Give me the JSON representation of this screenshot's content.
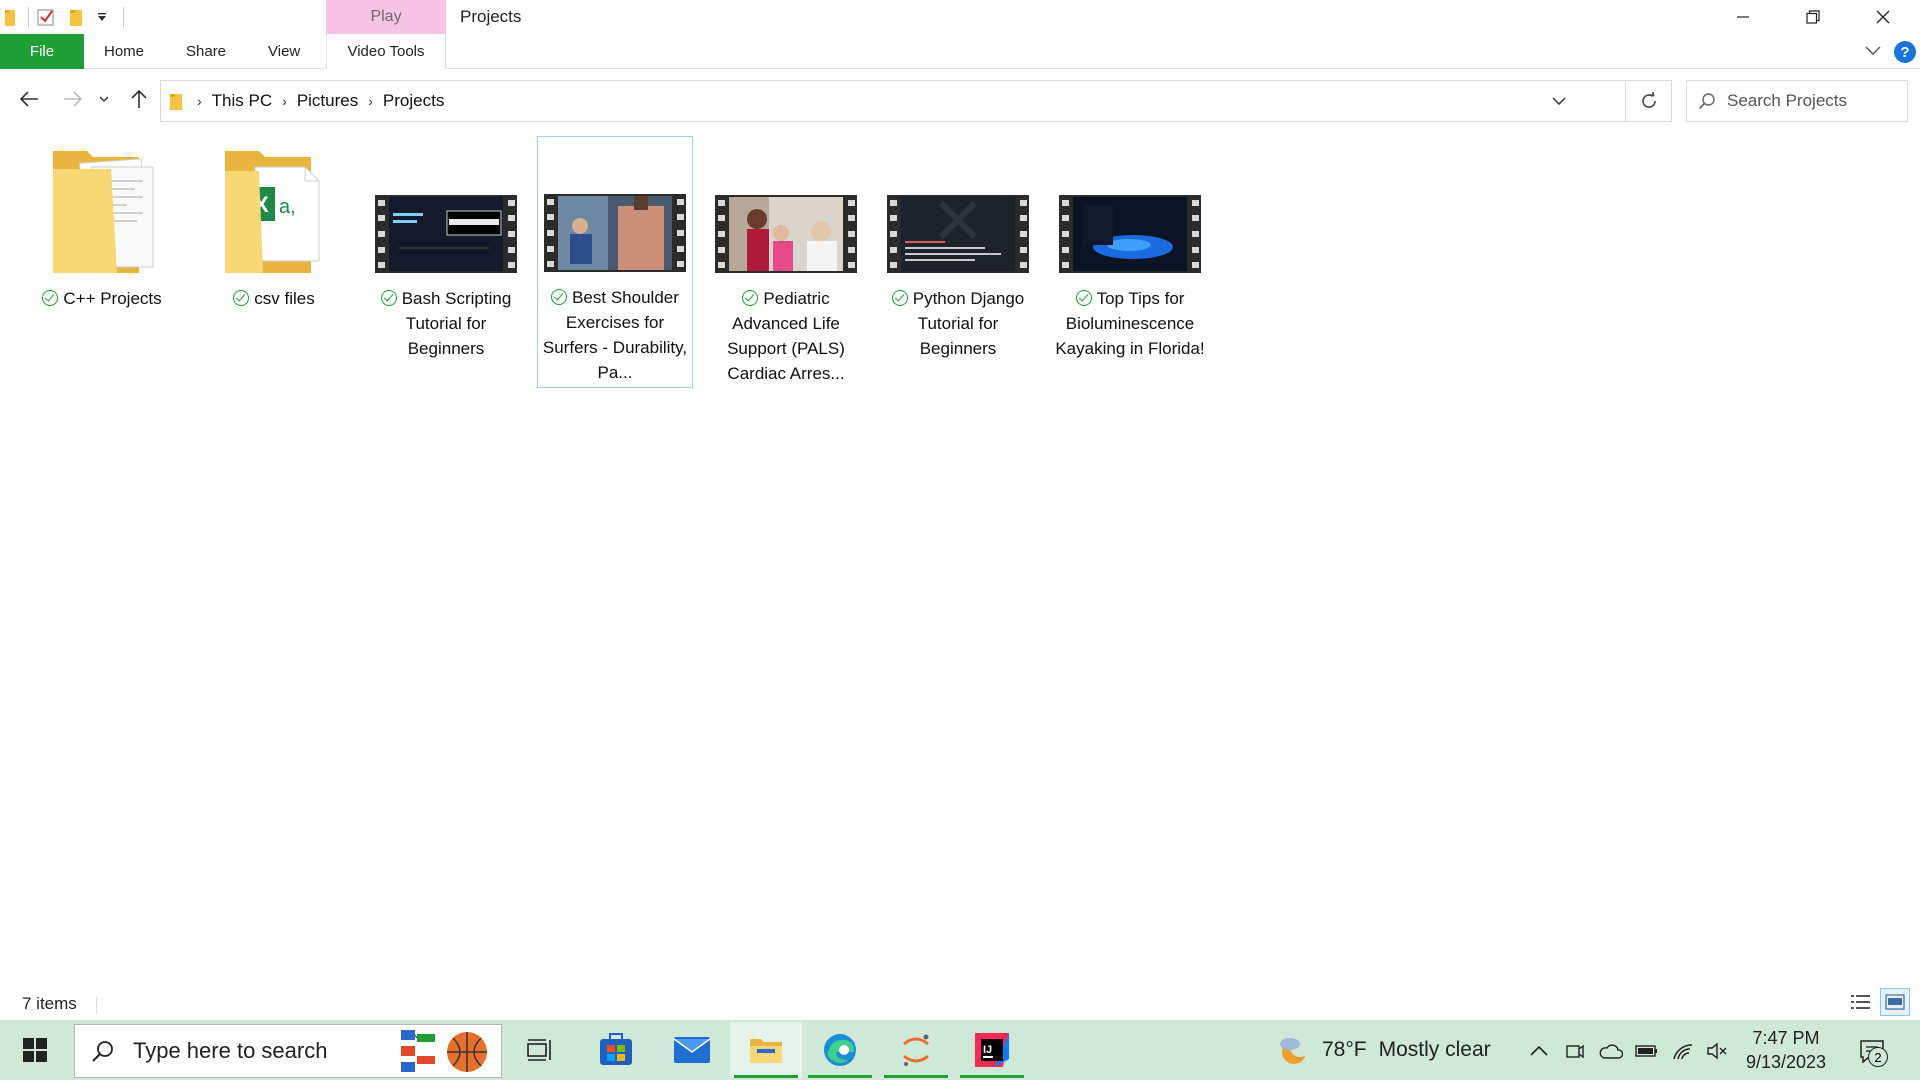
{
  "window": {
    "contextual_tab": "Play",
    "title": "Projects"
  },
  "ribbon": {
    "file": "File",
    "home": "Home",
    "share": "Share",
    "view": "View",
    "video_tools": "Video Tools"
  },
  "address": {
    "crumbs": [
      "This PC",
      "Pictures",
      "Projects"
    ],
    "search_placeholder": "Search Projects"
  },
  "items": [
    {
      "label": "C++ Projects",
      "type": "folder"
    },
    {
      "label": "csv files",
      "type": "folder-excel"
    },
    {
      "label": "Bash Scripting Tutorial for Beginners",
      "type": "video"
    },
    {
      "label": "Best Shoulder Exercises for Surfers - Durability, Pa...",
      "type": "video",
      "selected": true
    },
    {
      "label": "Pediatric Advanced Life Support (PALS) Cardiac Arres...",
      "type": "video"
    },
    {
      "label": "Python Django Tutorial for Beginners",
      "type": "video"
    },
    {
      "label": "Top Tips for Bioluminescence Kayaking in Florida!",
      "type": "video"
    }
  ],
  "status": {
    "count": "7 items"
  },
  "taskbar": {
    "search_text": "Type here to search",
    "weather_temp": "78°F",
    "weather_condition": "Mostly clear",
    "time": "7:47 PM",
    "date": "9/13/2023",
    "notification_count": "2"
  },
  "colors": {
    "file_tab": "#1f9e37",
    "contextual_tab": "#f8c4e3",
    "selection_border": "#99d1ff",
    "taskbar": "#cfe8d8"
  }
}
